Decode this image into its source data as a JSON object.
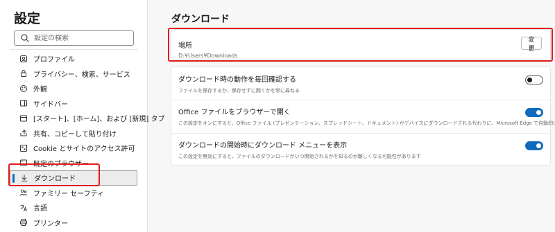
{
  "sidebar": {
    "title": "設定",
    "search_placeholder": "設定の検索",
    "items": [
      {
        "label": "プロファイル",
        "icon": "profile-icon"
      },
      {
        "label": "プライバシー、検索、サービス",
        "icon": "lock-icon"
      },
      {
        "label": "外観",
        "icon": "appearance-icon"
      },
      {
        "label": "サイドバー",
        "icon": "sidebar-icon"
      },
      {
        "label": "[スタート]、[ホーム]、および [新規] タブ",
        "icon": "home-icon"
      },
      {
        "label": "共有、コピーして貼り付け",
        "icon": "share-icon"
      },
      {
        "label": "Cookie とサイトのアクセス許可",
        "icon": "cookie-icon"
      },
      {
        "label": "既定のブラウザー",
        "icon": "browser-icon"
      },
      {
        "label": "ダウンロード",
        "icon": "download-icon",
        "active": true
      },
      {
        "label": "ファミリー セーフティ",
        "icon": "family-icon"
      },
      {
        "label": "言語",
        "icon": "language-icon"
      },
      {
        "label": "プリンター",
        "icon": "printer-icon"
      }
    ]
  },
  "main": {
    "title": "ダウンロード",
    "location": {
      "title": "場所",
      "path": "D:¥Users¥Downloads",
      "button": "変更"
    },
    "settings": [
      {
        "title": "ダウンロード時の動作を毎回確認する",
        "desc": "ファイルを保存するか、保存せずに開くかを常に尋ねる",
        "enabled": false
      },
      {
        "title": "Office ファイルをブラウザーで開く",
        "desc": "この設定をオンにすると、Office ファイル (プレゼンテーション、スプレッドシート、ドキュメント) がデバイスにダウンロードされる代わりに、Microsoft Edge で自動的に開きます",
        "enabled": true
      },
      {
        "title": "ダウンロードの開始時にダウンロード メニューを表示",
        "desc": "この設定を無効にすると、ファイルのダウンロードがいつ開始されるかを知るのが難しくなる可能性があります",
        "enabled": true
      }
    ]
  },
  "colors": {
    "accent": "#0f6cbd",
    "highlight": "#e31b1b"
  }
}
